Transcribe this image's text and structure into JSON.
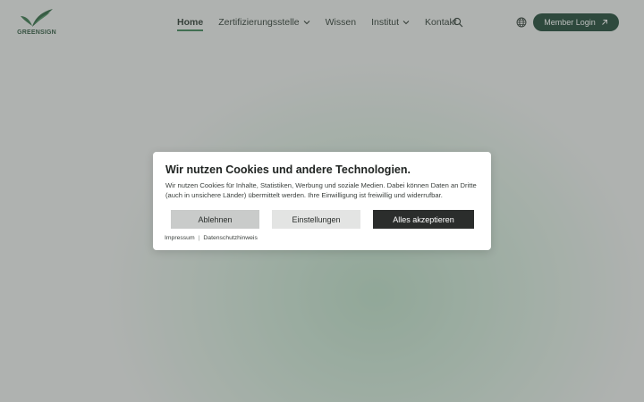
{
  "brand": {
    "logo_text": "GREENSIGN"
  },
  "nav": {
    "items": [
      {
        "label": "Home",
        "active": true,
        "dropdown": false
      },
      {
        "label": "Zertifizierungsstelle",
        "active": false,
        "dropdown": true
      },
      {
        "label": "Wissen",
        "active": false,
        "dropdown": false
      },
      {
        "label": "Institut",
        "active": false,
        "dropdown": true
      },
      {
        "label": "Kontakt",
        "active": false,
        "dropdown": false
      }
    ]
  },
  "header_actions": {
    "search_icon": "search-icon",
    "language_icon": "globe-icon",
    "member_login_label": "Member Login"
  },
  "cookie_dialog": {
    "title": "Wir nutzen Cookies und andere Technologien.",
    "text": "Wir nutzen Cookies für Inhalte, Statistiken, Werbung und soziale Medien. Dabei können Daten an Dritte (auch in unsichere Länder) übermittelt werden. Ihre Einwilligung ist freiwillig und widerrufbar.",
    "reject_label": "Ablehnen",
    "settings_label": "Einstellungen",
    "accept_label": "Alles akzeptieren",
    "links": {
      "imprint": "Impressum",
      "privacy": "Datenschutzhinweis"
    }
  },
  "colors": {
    "brand_dark_green": "#0f3a26",
    "accent_green": "#2f7a4a",
    "accept_button": "#2b2d2c",
    "reject_button": "#c9cbca"
  }
}
